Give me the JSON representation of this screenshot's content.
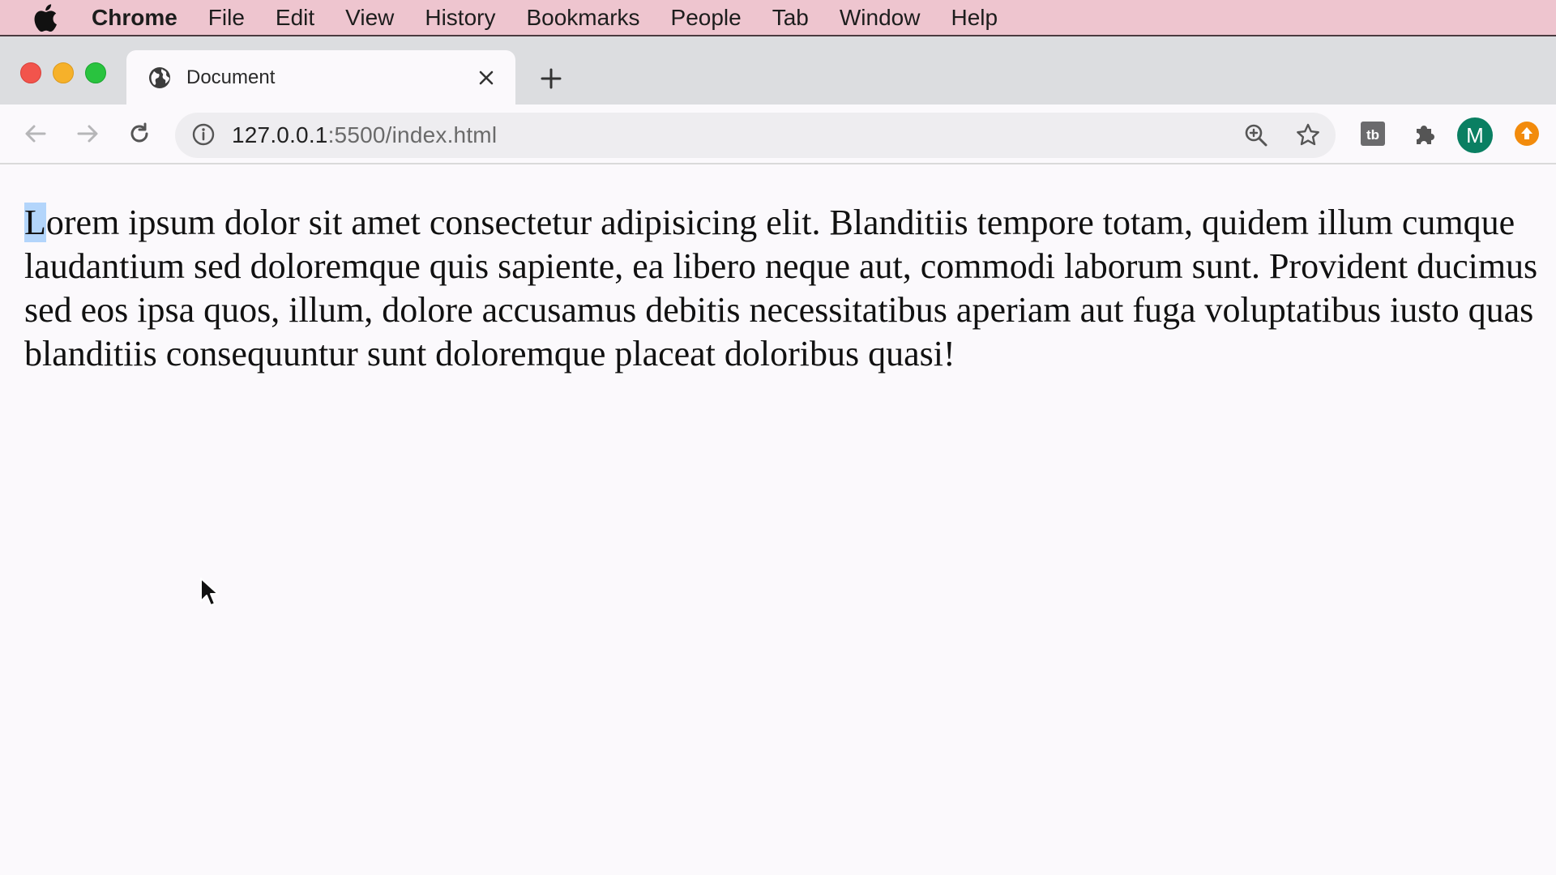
{
  "menubar": {
    "app": "Chrome",
    "items": [
      "File",
      "Edit",
      "View",
      "History",
      "Bookmarks",
      "People",
      "Tab",
      "Window",
      "Help"
    ]
  },
  "tab": {
    "title": "Document",
    "favicon": "globe-icon"
  },
  "toolbar": {
    "url_host": "127.0.0.1",
    "url_path": ":5500/index.html",
    "avatar_letter": "M"
  },
  "page": {
    "first_letter": "L",
    "paragraph": "orem ipsum dolor sit amet consectetur adipisicing elit. Blanditiis tempore totam, quidem illum cumque laudantium sed doloremque quis sapiente, ea libero neque aut, commodi laborum sunt. Provident ducimus sed eos ipsa quos, illum, dolore accusamus debitis necessitatibus aperiam aut fuga voluptatibus iusto quas blanditiis consequuntur sunt doloremque placeat doloribus quasi!"
  },
  "colors": {
    "menubar": "#eec5cf",
    "tabstrip": "#dcdde0",
    "page_bg": "#fbf9fc",
    "selection": "#b3d5fb",
    "avatar": "#0a7f62"
  }
}
